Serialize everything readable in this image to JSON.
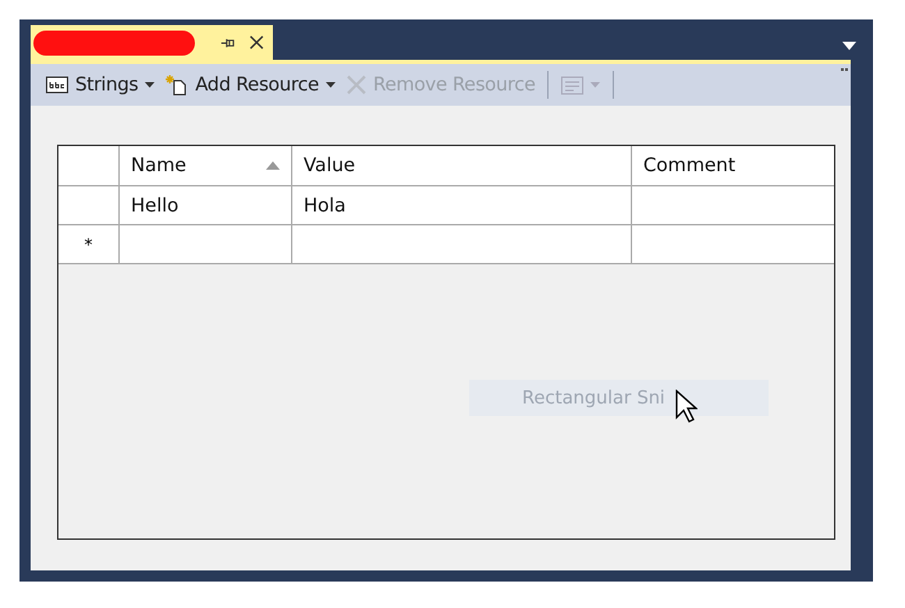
{
  "document_tab": {
    "redacted": true
  },
  "toolbar": [
    {
      "kind": "dropdown",
      "label": "Strings",
      "disabled": false
    },
    {
      "kind": "dropdown",
      "label": "Add Resource",
      "disabled": false
    },
    {
      "kind": "button",
      "label": "Remove Resource",
      "disabled": true
    },
    {
      "kind": "icon-dropdown",
      "disabled": true
    }
  ],
  "table": {
    "columns": [
      {
        "label": "Name",
        "sort_ascending": true
      },
      {
        "label": "Value"
      },
      {
        "label": "Comment"
      }
    ],
    "rows": [
      {
        "cells": [
          "Hello",
          "Hola"
        ]
      }
    ],
    "new_row": {
      "marker": "*"
    }
  },
  "snip_tooltip": {
    "label": "Rectangular Sni"
  }
}
